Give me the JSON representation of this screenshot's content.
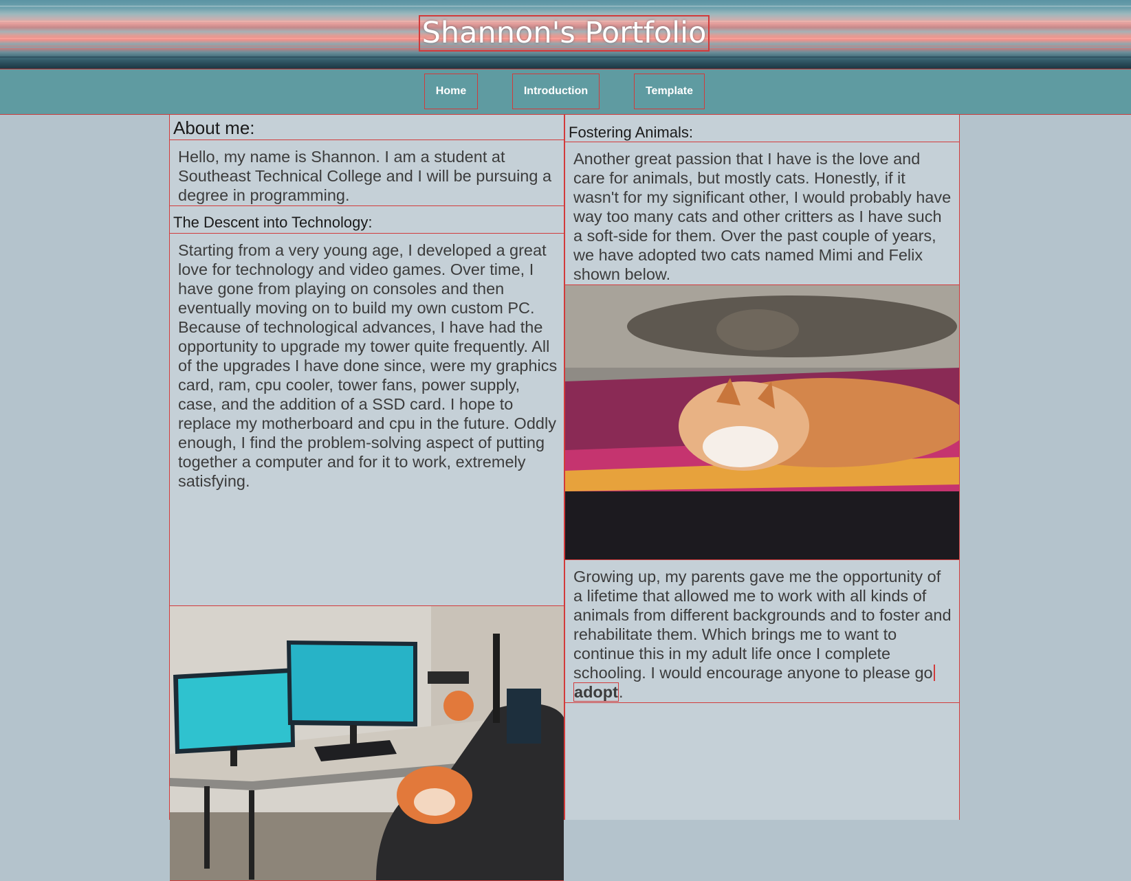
{
  "header": {
    "title": "Shannon's Portfolio"
  },
  "nav": {
    "items": [
      {
        "label": "Home"
      },
      {
        "label": "Introduction"
      },
      {
        "label": "Template"
      }
    ]
  },
  "left_column": {
    "about_heading": "About me:",
    "about_text": "Hello, my name is Shannon. I am a student at Southeast Technical College and I will be pursuing a degree in programming.",
    "tech_heading": "The Descent into Technology:",
    "tech_text": "Starting from a very young age, I developed a great love for technology and video games. Over time, I have gone from playing on consoles and then eventually moving on to build my own custom PC. Because of technological advances, I have had the opportunity to upgrade my tower quite frequently. All of the upgrades I have done since, were my graphics card, ram, cpu cooler, tower fans, power supply, case, and the addition of a SSD card. I hope to replace my motherboard and cpu in the future. Oddly enough, I find the problem-solving aspect of putting together a computer and for it to work, extremely satisfying."
  },
  "right_column": {
    "fostering_heading": "Fostering Animals:",
    "fostering_text": "Another great passion that I have is the love and care for animals, but mostly cats. Honestly, if it wasn't for my significant other, I would probably have way too many cats and other critters as I have such a soft-side for them. Over the past couple of years, we have adopted two cats named Mimi and Felix shown below.",
    "growing_text": "Growing up, my parents gave me the opportunity of a lifetime that allowed me to work with all kinds of animals from different backgrounds and to foster and rehabilitate them. Which brings me to want to continue this in my adult life once I complete schooling. I would encourage anyone to please go",
    "adopt_link": "adopt",
    "period": "."
  },
  "colors": {
    "page_bg": "#b4c3cc",
    "navbar_bg": "#5f9ba1",
    "column_bg": "#c5d0d7",
    "outline": "#d23a3a"
  }
}
